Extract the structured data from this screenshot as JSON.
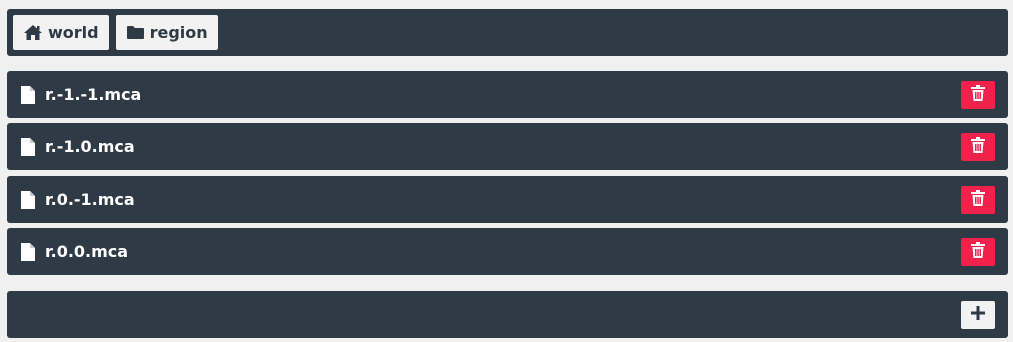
{
  "breadcrumb": [
    {
      "label": "world",
      "icon": "home-icon"
    },
    {
      "label": "region",
      "icon": "folder-icon"
    }
  ],
  "files": [
    {
      "name": "r.-1.-1.mca"
    },
    {
      "name": "r.-1.0.mca"
    },
    {
      "name": "r.0.-1.mca"
    },
    {
      "name": "r.0.0.mca"
    }
  ],
  "icons": {
    "file": "file-icon",
    "delete": "trash-icon",
    "add": "plus-icon"
  },
  "colors": {
    "panel": "#2e3a45",
    "background": "#f0f0f0",
    "delete_button": "#f0224b",
    "light_button": "#f2f2f2"
  }
}
